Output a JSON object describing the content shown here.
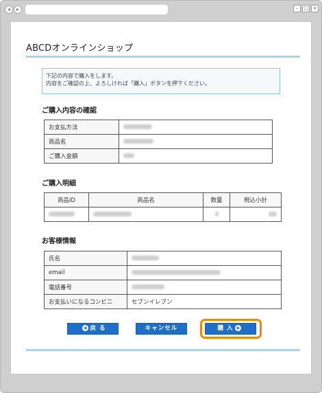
{
  "browser": {
    "back_glyph": "◂",
    "forward_glyph": "▸",
    "minimize_glyph": "–",
    "maximize_glyph": "□",
    "close_glyph": "×"
  },
  "page": {
    "shop_title": "ABCDオンラインショップ",
    "notice_line1": "下記の内容で購入をします。",
    "notice_line2": "内容をご確認の上、よろしければ「購入」ボタンを押下ください。"
  },
  "purchase_confirm": {
    "heading": "ご購入内容の確認",
    "rows": [
      {
        "label": "お支払方法",
        "value": ""
      },
      {
        "label": "商品名",
        "value": ""
      },
      {
        "label": "ご購入金額",
        "value": ""
      }
    ]
  },
  "purchase_details": {
    "heading": "ご購入明細",
    "columns": [
      "商品ID",
      "商品名",
      "数量",
      "税込小計"
    ]
  },
  "customer_info": {
    "heading": "お客様情報",
    "rows": [
      {
        "label": "氏名",
        "value": ""
      },
      {
        "label": "email",
        "value": ""
      },
      {
        "label": "電話番号",
        "value": ""
      },
      {
        "label": "お支払いになるコンビニ",
        "value": "セブンイレブン"
      }
    ]
  },
  "buttons": {
    "back_label": "戻 る",
    "cancel_label": "キャンセル",
    "buy_label": "購 入",
    "arrow_left_glyph": "◀",
    "arrow_right_glyph": "▶"
  },
  "colors": {
    "accent_rule": "#a8d4e6",
    "button_blue": "#1f6fc9",
    "highlight_orange": "#f08a00"
  }
}
